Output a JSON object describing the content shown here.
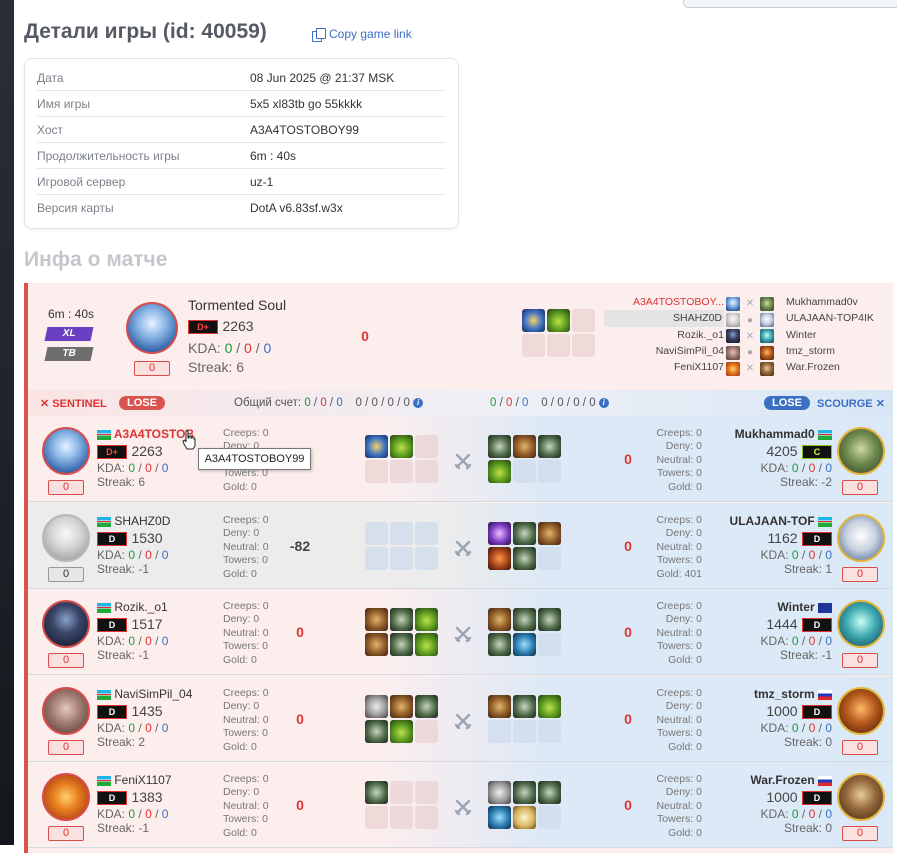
{
  "page": {
    "title": "Детали игры (id: 40059)",
    "copy_link": "Copy game link",
    "match_section_title": "Инфа о матче"
  },
  "details": [
    {
      "label": "Дата",
      "value": "08 Jun 2025 @ 21:37 MSK"
    },
    {
      "label": "Имя игры",
      "value": "5x5 xl83tb go 55kkkk"
    },
    {
      "label": "Хост",
      "value": "A3A4TOSTOBOY99"
    },
    {
      "label": "Продолжительность игры",
      "value": "6m : 40s"
    },
    {
      "label": "Игровой сервер",
      "value": "uz-1"
    },
    {
      "label": "Версия карты",
      "value": "DotA v6.83sf.w3x"
    }
  ],
  "summary": {
    "duration": "6m : 40s",
    "mode1": "XL",
    "mode2": "TB",
    "hero_name": "Tormented Soul",
    "rank": "D+",
    "rating": "2263",
    "kda_label": "KDA:",
    "kda": [
      "0",
      "0",
      "0"
    ],
    "streak_label": "Streak:",
    "streak": "6",
    "score": "0",
    "diff": "0",
    "sentinel_players": [
      "A3A4TOSTOBOY...",
      "SHAHZ0D",
      "Rozik._o1",
      "NaviSimPil_04",
      "FeniX1107"
    ],
    "scourge_players": [
      "Mukhammad0v",
      "ULAJAAN-TOP4IK",
      "Winter",
      "tmz_storm",
      "War.Frozen"
    ]
  },
  "sides": {
    "sentinel": "SENTINEL",
    "sentinel_result": "LOSE",
    "total_label": "Общий счет:",
    "sentinel_kda": [
      "0",
      "0",
      "0"
    ],
    "sentinel_extra": [
      "0",
      "0",
      "0",
      "0"
    ],
    "scourge_kda": [
      "0",
      "0",
      "0"
    ],
    "scourge_extra": [
      "0",
      "0",
      "0",
      "0"
    ],
    "scourge_result": "LOSE",
    "scourge": "SCOURGE"
  },
  "labels": {
    "creeps": "Creeps:",
    "deny": "Deny:",
    "neutral": "Neutral:",
    "towers": "Towers:",
    "gold": "Gold:",
    "kda": "KDA:",
    "streak": "Streak:"
  },
  "rows": [
    {
      "left": {
        "name": "A3A4TOSTOB",
        "rank": "D+",
        "rating": "2263",
        "kda": [
          "0",
          "0",
          "0"
        ],
        "streak": "6",
        "score": "0",
        "creeps": "0",
        "deny": "0",
        "neutral": "0",
        "towers": "0",
        "gold": "0"
      },
      "diff_left": "0",
      "diff_right": "0",
      "right": {
        "name": "Mukhammad0",
        "rank": "C",
        "rating": "4205",
        "kda": [
          "0",
          "0",
          "0"
        ],
        "streak": "-2",
        "score": "0",
        "creeps": "0",
        "deny": "0",
        "neutral": "0",
        "towers": "0",
        "gold": "0"
      }
    },
    {
      "left": {
        "name": "SHAHZ0D",
        "rank": "D",
        "rating": "1530",
        "kda": [
          "0",
          "0",
          "0"
        ],
        "streak": "-1",
        "score": "0",
        "creeps": "0",
        "deny": "0",
        "neutral": "0",
        "towers": "0",
        "gold": "0"
      },
      "diff_left": "-82",
      "diff_right": "0",
      "right": {
        "name": "ULAJAAN-TOF",
        "rank": "D",
        "rating": "1162",
        "kda": [
          "0",
          "0",
          "0"
        ],
        "streak": "1",
        "score": "0",
        "creeps": "0",
        "deny": "0",
        "neutral": "0",
        "towers": "0",
        "gold": "401"
      }
    },
    {
      "left": {
        "name": "Rozik._o1",
        "rank": "D",
        "rating": "1517",
        "kda": [
          "0",
          "0",
          "0"
        ],
        "streak": "-1",
        "score": "0",
        "creeps": "0",
        "deny": "0",
        "neutral": "0",
        "towers": "0",
        "gold": "0"
      },
      "diff_left": "0",
      "diff_right": "0",
      "right": {
        "name": "Winter",
        "rank": "D",
        "rating": "1444",
        "kda": [
          "0",
          "0",
          "0"
        ],
        "streak": "-1",
        "score": "0",
        "creeps": "0",
        "deny": "0",
        "neutral": "0",
        "towers": "0",
        "gold": "0"
      }
    },
    {
      "left": {
        "name": "NaviSimPil_04",
        "rank": "D",
        "rating": "1435",
        "kda": [
          "0",
          "0",
          "0"
        ],
        "streak": "2",
        "score": "0",
        "creeps": "0",
        "deny": "0",
        "neutral": "0",
        "towers": "0",
        "gold": "0"
      },
      "diff_left": "0",
      "diff_right": "0",
      "right": {
        "name": "tmz_storm",
        "rank": "D",
        "rating": "1000",
        "kda": [
          "0",
          "0",
          "0"
        ],
        "streak": "0",
        "score": "0",
        "creeps": "0",
        "deny": "0",
        "neutral": "0",
        "towers": "0",
        "gold": "0"
      }
    },
    {
      "left": {
        "name": "FeniX1107",
        "rank": "D",
        "rating": "1383",
        "kda": [
          "0",
          "0",
          "0"
        ],
        "streak": "-1",
        "score": "0",
        "creeps": "0",
        "deny": "0",
        "neutral": "0",
        "towers": "0",
        "gold": "0"
      },
      "diff_left": "0",
      "diff_right": "0",
      "right": {
        "name": "War.Frozen",
        "rank": "D",
        "rating": "1000",
        "kda": [
          "0",
          "0",
          "0"
        ],
        "streak": "0",
        "score": "0",
        "creeps": "0",
        "deny": "0",
        "neutral": "0",
        "towers": "0",
        "gold": "0"
      }
    }
  ],
  "tooltip": "A3A4TOSTOBOY99",
  "colors": {
    "win": "#1d9b3a",
    "lose": "#d33",
    "accent": "#3a6fc4"
  }
}
